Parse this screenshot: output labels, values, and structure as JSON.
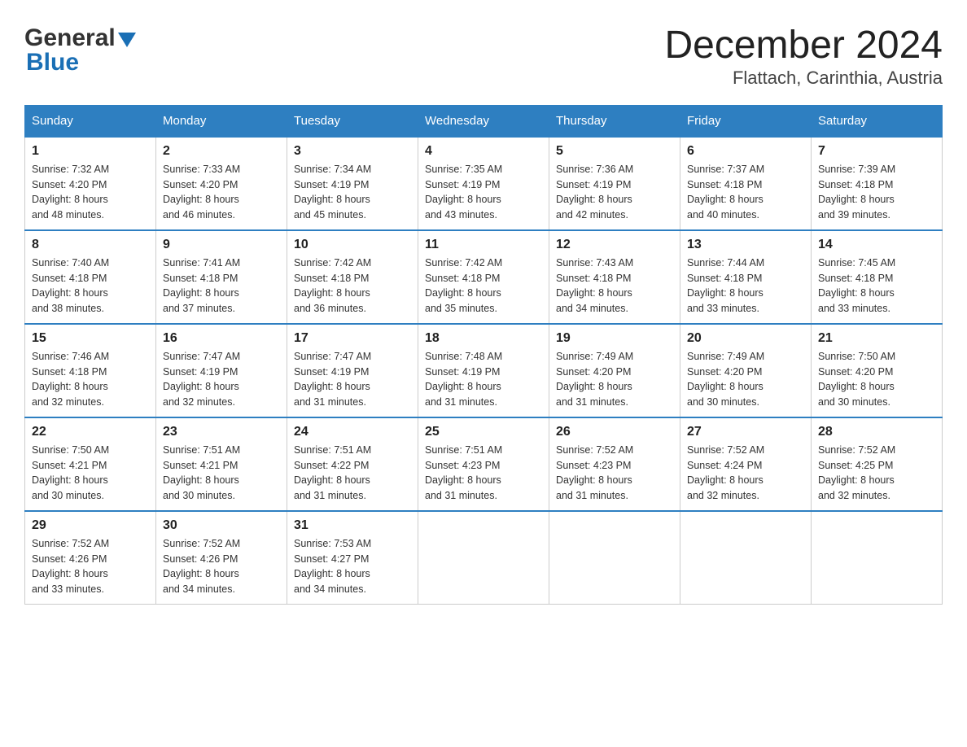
{
  "header": {
    "logo_general": "General",
    "logo_blue": "Blue",
    "title": "December 2024",
    "subtitle": "Flattach, Carinthia, Austria"
  },
  "weekdays": [
    "Sunday",
    "Monday",
    "Tuesday",
    "Wednesday",
    "Thursday",
    "Friday",
    "Saturday"
  ],
  "weeks": [
    [
      {
        "day": "1",
        "sunrise": "7:32 AM",
        "sunset": "4:20 PM",
        "daylight": "8 hours and 48 minutes."
      },
      {
        "day": "2",
        "sunrise": "7:33 AM",
        "sunset": "4:20 PM",
        "daylight": "8 hours and 46 minutes."
      },
      {
        "day": "3",
        "sunrise": "7:34 AM",
        "sunset": "4:19 PM",
        "daylight": "8 hours and 45 minutes."
      },
      {
        "day": "4",
        "sunrise": "7:35 AM",
        "sunset": "4:19 PM",
        "daylight": "8 hours and 43 minutes."
      },
      {
        "day": "5",
        "sunrise": "7:36 AM",
        "sunset": "4:19 PM",
        "daylight": "8 hours and 42 minutes."
      },
      {
        "day": "6",
        "sunrise": "7:37 AM",
        "sunset": "4:18 PM",
        "daylight": "8 hours and 40 minutes."
      },
      {
        "day": "7",
        "sunrise": "7:39 AM",
        "sunset": "4:18 PM",
        "daylight": "8 hours and 39 minutes."
      }
    ],
    [
      {
        "day": "8",
        "sunrise": "7:40 AM",
        "sunset": "4:18 PM",
        "daylight": "8 hours and 38 minutes."
      },
      {
        "day": "9",
        "sunrise": "7:41 AM",
        "sunset": "4:18 PM",
        "daylight": "8 hours and 37 minutes."
      },
      {
        "day": "10",
        "sunrise": "7:42 AM",
        "sunset": "4:18 PM",
        "daylight": "8 hours and 36 minutes."
      },
      {
        "day": "11",
        "sunrise": "7:42 AM",
        "sunset": "4:18 PM",
        "daylight": "8 hours and 35 minutes."
      },
      {
        "day": "12",
        "sunrise": "7:43 AM",
        "sunset": "4:18 PM",
        "daylight": "8 hours and 34 minutes."
      },
      {
        "day": "13",
        "sunrise": "7:44 AM",
        "sunset": "4:18 PM",
        "daylight": "8 hours and 33 minutes."
      },
      {
        "day": "14",
        "sunrise": "7:45 AM",
        "sunset": "4:18 PM",
        "daylight": "8 hours and 33 minutes."
      }
    ],
    [
      {
        "day": "15",
        "sunrise": "7:46 AM",
        "sunset": "4:18 PM",
        "daylight": "8 hours and 32 minutes."
      },
      {
        "day": "16",
        "sunrise": "7:47 AM",
        "sunset": "4:19 PM",
        "daylight": "8 hours and 32 minutes."
      },
      {
        "day": "17",
        "sunrise": "7:47 AM",
        "sunset": "4:19 PM",
        "daylight": "8 hours and 31 minutes."
      },
      {
        "day": "18",
        "sunrise": "7:48 AM",
        "sunset": "4:19 PM",
        "daylight": "8 hours and 31 minutes."
      },
      {
        "day": "19",
        "sunrise": "7:49 AM",
        "sunset": "4:20 PM",
        "daylight": "8 hours and 31 minutes."
      },
      {
        "day": "20",
        "sunrise": "7:49 AM",
        "sunset": "4:20 PM",
        "daylight": "8 hours and 30 minutes."
      },
      {
        "day": "21",
        "sunrise": "7:50 AM",
        "sunset": "4:20 PM",
        "daylight": "8 hours and 30 minutes."
      }
    ],
    [
      {
        "day": "22",
        "sunrise": "7:50 AM",
        "sunset": "4:21 PM",
        "daylight": "8 hours and 30 minutes."
      },
      {
        "day": "23",
        "sunrise": "7:51 AM",
        "sunset": "4:21 PM",
        "daylight": "8 hours and 30 minutes."
      },
      {
        "day": "24",
        "sunrise": "7:51 AM",
        "sunset": "4:22 PM",
        "daylight": "8 hours and 31 minutes."
      },
      {
        "day": "25",
        "sunrise": "7:51 AM",
        "sunset": "4:23 PM",
        "daylight": "8 hours and 31 minutes."
      },
      {
        "day": "26",
        "sunrise": "7:52 AM",
        "sunset": "4:23 PM",
        "daylight": "8 hours and 31 minutes."
      },
      {
        "day": "27",
        "sunrise": "7:52 AM",
        "sunset": "4:24 PM",
        "daylight": "8 hours and 32 minutes."
      },
      {
        "day": "28",
        "sunrise": "7:52 AM",
        "sunset": "4:25 PM",
        "daylight": "8 hours and 32 minutes."
      }
    ],
    [
      {
        "day": "29",
        "sunrise": "7:52 AM",
        "sunset": "4:26 PM",
        "daylight": "8 hours and 33 minutes."
      },
      {
        "day": "30",
        "sunrise": "7:52 AM",
        "sunset": "4:26 PM",
        "daylight": "8 hours and 34 minutes."
      },
      {
        "day": "31",
        "sunrise": "7:53 AM",
        "sunset": "4:27 PM",
        "daylight": "8 hours and 34 minutes."
      },
      null,
      null,
      null,
      null
    ]
  ],
  "labels": {
    "sunrise": "Sunrise:",
    "sunset": "Sunset:",
    "daylight": "Daylight:"
  }
}
